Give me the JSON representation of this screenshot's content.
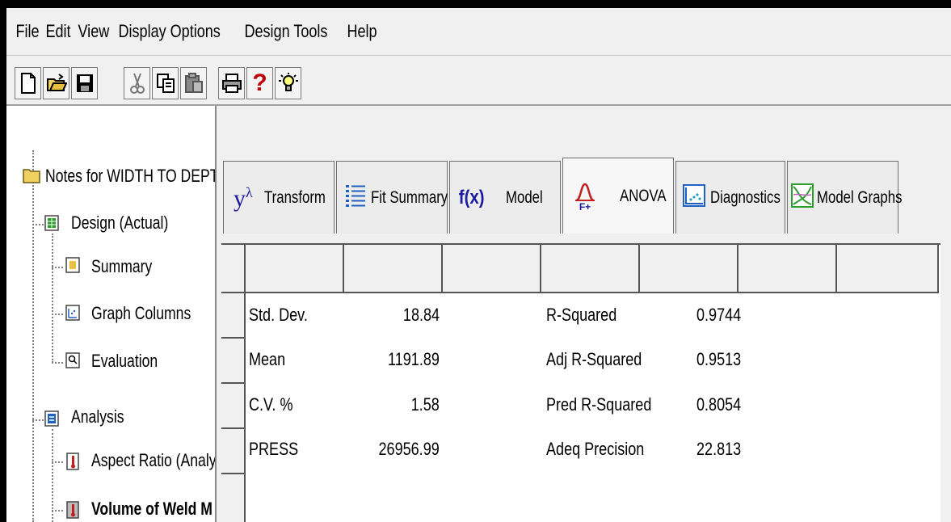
{
  "menu": [
    "File",
    "Edit",
    "View",
    "Display Options",
    "Design Tools",
    "Help"
  ],
  "toolbar": {
    "icons": [
      "new-document-icon",
      "open-folder-icon",
      "save-disk-icon",
      "cut-scissors-icon",
      "copy-icon",
      "paste-icon",
      "print-icon",
      "help-question-icon",
      "tip-lightbulb-icon"
    ]
  },
  "tree": {
    "root": "Notes for WIDTH TO DEPTH",
    "design": "Design (Actual)",
    "summary": "Summary",
    "graph_columns": "Graph Columns",
    "evaluation": "Evaluation",
    "analysis": "Analysis",
    "aspect_ratio": "Aspect Ratio (Analy",
    "volume_of_weld": "Volume of Weld M"
  },
  "tabs": [
    {
      "label": "Transform",
      "prefix": "y",
      "sup": "λ"
    },
    {
      "label": "Fit Summary"
    },
    {
      "label": "Model",
      "prefix": "f(x)"
    },
    {
      "label": "ANOVA",
      "sublabel": "F+"
    },
    {
      "label": "Diagnostics"
    },
    {
      "label": "Model Graphs"
    }
  ],
  "active_tab": "ANOVA",
  "stats": [
    {
      "label": "Std. Dev.",
      "value": "18.84",
      "label2": "R-Squared",
      "value2": "0.9744"
    },
    {
      "label": "Mean",
      "value": "1191.89",
      "label2": "Adj R-Squared",
      "value2": "0.9513"
    },
    {
      "label": "C.V. %",
      "value": "1.58",
      "label2": "Pred R-Squared",
      "value2": "0.8054"
    },
    {
      "label": "PRESS",
      "value": "26956.99",
      "label2": "Adeq Precision",
      "value2": "22.813"
    }
  ],
  "colors": {
    "window_bg": "#f0f0f0",
    "grid_bg": "#ffffff",
    "folder_yellow": "#f0d060",
    "green_icon": "#2a9d2a",
    "blue_icon": "#2060c0",
    "red_icon": "#c02020"
  }
}
